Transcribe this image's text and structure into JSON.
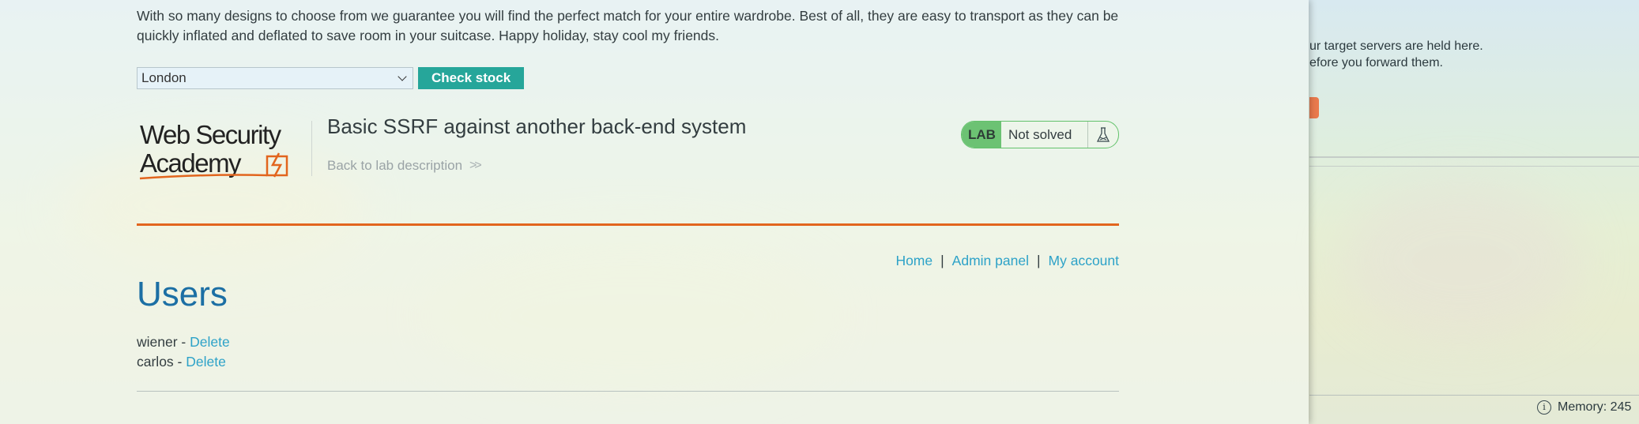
{
  "description": "With so many designs to choose from we guarantee you will find the perfect match for your entire wardrobe. Best of all, they are easy to transport as they can be quickly inflated and deflated to save room in your suitcase. Happy holiday, stay cool my friends.",
  "stock_check": {
    "selected_city": "London",
    "button_label": "Check stock"
  },
  "header": {
    "logo_line1": "Web Security",
    "logo_line2": "Academy",
    "lab_title": "Basic SSRF against another back-end system",
    "back_link": "Back to lab description",
    "badge_lab": "LAB",
    "badge_status": "Not solved"
  },
  "nav": {
    "home": "Home",
    "separator": "|",
    "admin": "Admin panel",
    "account": "My account"
  },
  "users": {
    "title": "Users",
    "rows": [
      {
        "name": "wiener - ",
        "action": "Delete"
      },
      {
        "name": "carlos - ",
        "action": "Delete"
      }
    ]
  },
  "right_panel": {
    "line1": "ur target servers are held here.",
    "line2": "efore you forward them.",
    "memory": "Memory: 245"
  },
  "colors": {
    "accent_teal": "#26a69a",
    "link_blue": "#2da2c8",
    "title_blue": "#1c6fa4",
    "orange": "#e2651e",
    "lab_green": "#6cc273"
  }
}
